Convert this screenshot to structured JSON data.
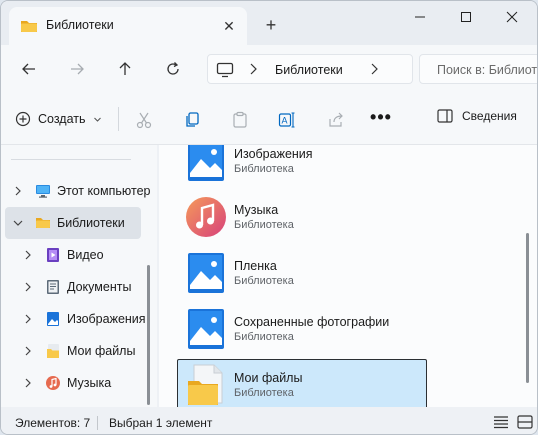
{
  "window": {
    "tab_title": "Библиотеки",
    "tab_close_glyph": "✕",
    "new_tab_glyph": "+"
  },
  "address": {
    "breadcrumb_label": "Библиотеки",
    "search_placeholder": "Поиск в: Библиотеки"
  },
  "toolbar": {
    "create_label": "Создать",
    "more_label": "•••",
    "details_label": "Сведения"
  },
  "nav": {
    "items": [
      {
        "label": "Этот компьютер",
        "icon": "pc-icon",
        "expanded": false,
        "selected": false
      },
      {
        "label": "Библиотеки",
        "icon": "folder-icon",
        "expanded": true,
        "selected": true
      },
      {
        "label": "Видео",
        "icon": "video-library-icon",
        "expanded": false,
        "selected": false
      },
      {
        "label": "Документы",
        "icon": "documents-library-icon",
        "expanded": false,
        "selected": false
      },
      {
        "label": "Изображения",
        "icon": "pictures-library-icon",
        "expanded": false,
        "selected": false
      },
      {
        "label": "Мои файлы",
        "icon": "folder-library-icon",
        "expanded": false,
        "selected": false
      },
      {
        "label": "Музыка",
        "icon": "music-library-icon",
        "expanded": false,
        "selected": false
      }
    ]
  },
  "content": {
    "items": [
      {
        "name": "Изображения",
        "type": "Библиотека",
        "icon": "pictures-library-icon",
        "selected": false
      },
      {
        "name": "Музыка",
        "type": "Библиотека",
        "icon": "music-library-icon",
        "selected": false
      },
      {
        "name": "Пленка",
        "type": "Библиотека",
        "icon": "camera-roll-library-icon",
        "selected": false
      },
      {
        "name": "Сохраненные фотографии",
        "type": "Библиотека",
        "icon": "saved-pictures-library-icon",
        "selected": false
      },
      {
        "name": "Мои файлы",
        "type": "Библиотека",
        "icon": "folder-library-icon",
        "selected": true
      }
    ]
  },
  "status": {
    "item_count": "Элементов: 7",
    "selection": "Выбран 1 элемент"
  },
  "colors": {
    "accent": "#0067c0",
    "selection_bg": "#cce8fb",
    "folder_yellow": "#f8c94a"
  }
}
